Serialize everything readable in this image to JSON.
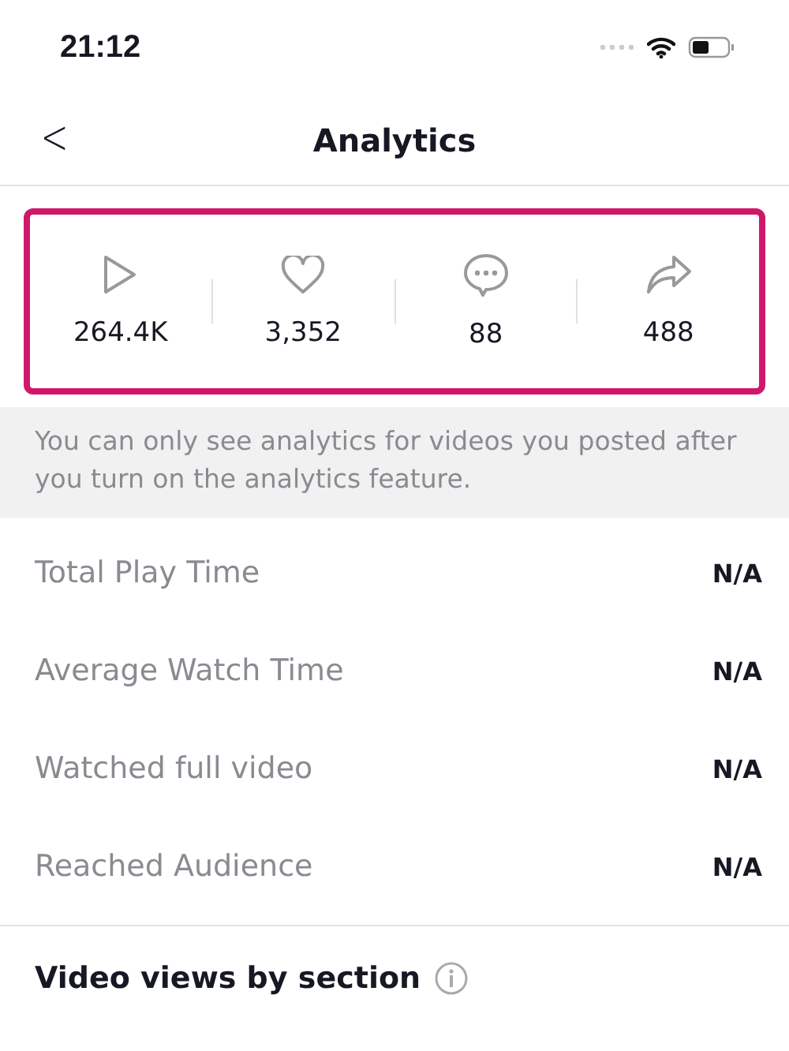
{
  "status_bar": {
    "time": "21:12"
  },
  "header": {
    "back": "<",
    "title": "Analytics"
  },
  "stats": [
    {
      "kind": "play",
      "value": "264.4K"
    },
    {
      "kind": "like",
      "value": "3,352"
    },
    {
      "kind": "comment",
      "value": "88"
    },
    {
      "kind": "share",
      "value": "488"
    }
  ],
  "notice": "You can only see analytics for videos you posted after you turn on the analytics feature.",
  "metrics": [
    {
      "label": "Total Play Time",
      "value": "N/A"
    },
    {
      "label": "Average Watch Time",
      "value": "N/A"
    },
    {
      "label": "Watched full video",
      "value": "N/A"
    },
    {
      "label": "Reached Audience",
      "value": "N/A"
    }
  ],
  "section": {
    "title": "Video views by section"
  }
}
